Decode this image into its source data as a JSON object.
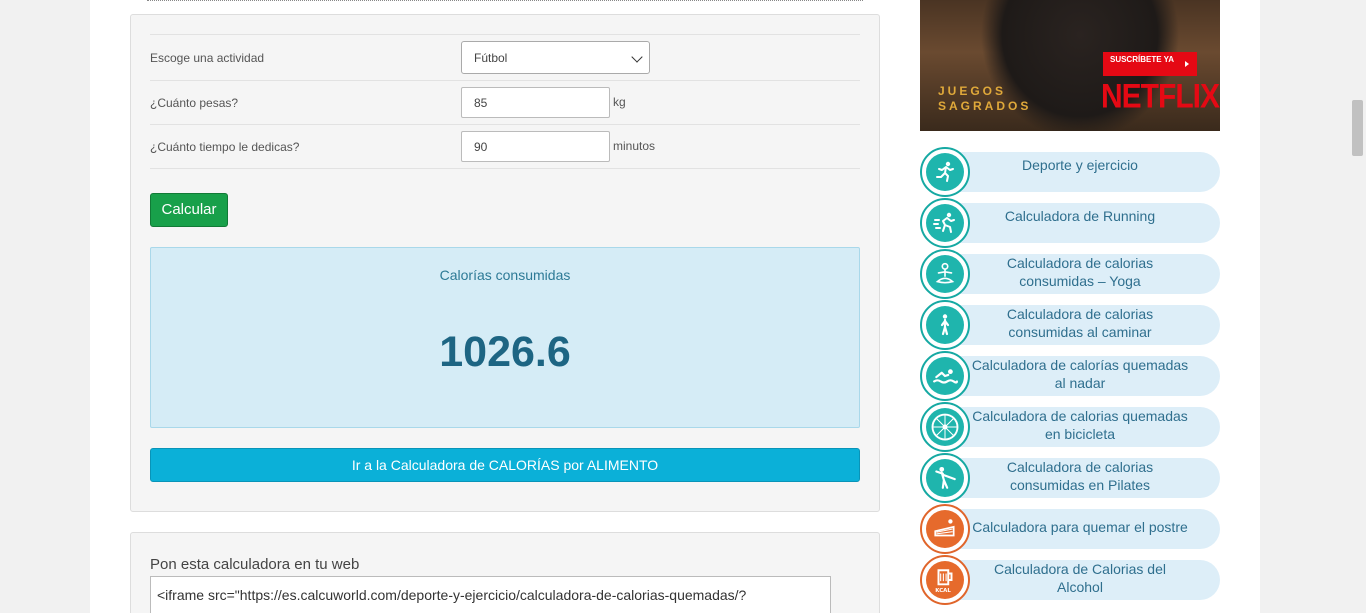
{
  "form": {
    "activity_label": "Escoge una actividad",
    "activity_value": "Fútbol",
    "weight_label": "¿Cuánto pesas?",
    "weight_value": "85",
    "weight_unit": "kg",
    "time_label": "¿Cuánto tiempo le dedicas?",
    "time_value": "90",
    "time_unit": "minutos",
    "calc_button": "Calcular"
  },
  "result": {
    "title": "Calorías consumidas",
    "value": "1026.6"
  },
  "food_button": "Ir a la Calculadora de CALORÍAS por ALIMENTO",
  "embed": {
    "title": "Pon esta calculadora en tu web",
    "code": "<iframe src=\"https://es.calcuworld.com/deporte-y-ejercicio/calculadora-de-calorias-quemadas/?"
  },
  "ad": {
    "subscribe": "SUSCRÍBETE YA",
    "show_title_1": "JUEGOS",
    "show_title_2": "SAGRADOS",
    "brand": "NETFLIX"
  },
  "sidebar": {
    "items": [
      {
        "label": "Deporte y ejercicio",
        "icon": "runner-icon"
      },
      {
        "label": "Calculadora de Running",
        "icon": "running-fast-icon"
      },
      {
        "label": "Calculadora de calorias consumidas – Yoga",
        "icon": "yoga-icon"
      },
      {
        "label": "Calculadora de calorias consumidas al caminar",
        "icon": "walking-icon"
      },
      {
        "label": "Calculadora de calorías quemadas al nadar",
        "icon": "swimming-icon"
      },
      {
        "label": "Calculadora de calorias quemadas en bicicleta",
        "icon": "bicycle-wheel-icon"
      },
      {
        "label": "Calculadora de calorias consumidas en Pilates",
        "icon": "pilates-icon"
      },
      {
        "label": "Calculadora para quemar el postre",
        "icon": "cake-icon"
      },
      {
        "label": "Calculadora de Calorias del Alcohol",
        "icon": "beer-kcal-icon"
      }
    ]
  },
  "colors": {
    "teal": "#1fb5ad",
    "orange": "#e66a2c",
    "green_button": "#18a04a",
    "blue_button": "#0bb0d8",
    "result_bg": "#d5ecf6"
  }
}
